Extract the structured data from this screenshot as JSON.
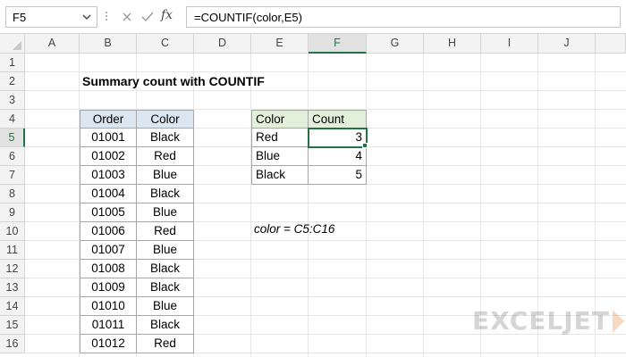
{
  "formula_bar": {
    "name_box": "F5",
    "fx": "fx",
    "formula": "=COUNTIF(color,E5)"
  },
  "columns": [
    "A",
    "B",
    "C",
    "D",
    "E",
    "F",
    "G",
    "H",
    "I",
    "J"
  ],
  "active_column": "F",
  "rows": [
    "1",
    "2",
    "3",
    "4",
    "5",
    "6",
    "7",
    "8",
    "9",
    "10",
    "11",
    "12",
    "13",
    "14",
    "15",
    "16"
  ],
  "active_row": "5",
  "title": "Summary count with COUNTIF",
  "orders_table": {
    "headers": [
      "Order",
      "Color"
    ],
    "rows": [
      [
        "01001",
        "Black"
      ],
      [
        "01002",
        "Red"
      ],
      [
        "01003",
        "Blue"
      ],
      [
        "01004",
        "Black"
      ],
      [
        "01005",
        "Blue"
      ],
      [
        "01006",
        "Red"
      ],
      [
        "01007",
        "Blue"
      ],
      [
        "01008",
        "Black"
      ],
      [
        "01009",
        "Black"
      ],
      [
        "01010",
        "Blue"
      ],
      [
        "01011",
        "Black"
      ],
      [
        "01012",
        "Red"
      ]
    ]
  },
  "summary_table": {
    "headers": [
      "Color",
      "Count"
    ],
    "rows": [
      [
        "Red",
        "3"
      ],
      [
        "Blue",
        "4"
      ],
      [
        "Black",
        "5"
      ]
    ]
  },
  "named_range_note": "color = C5:C16",
  "watermark": "EXCELJET",
  "colors": {
    "accent": "#217346",
    "header_blue": "#dce6f1",
    "header_green": "#e2efda",
    "brand_orange": "#e5772b"
  },
  "icons": [
    "chevron-down-icon",
    "cancel-icon",
    "enter-icon",
    "fx-icon"
  ]
}
